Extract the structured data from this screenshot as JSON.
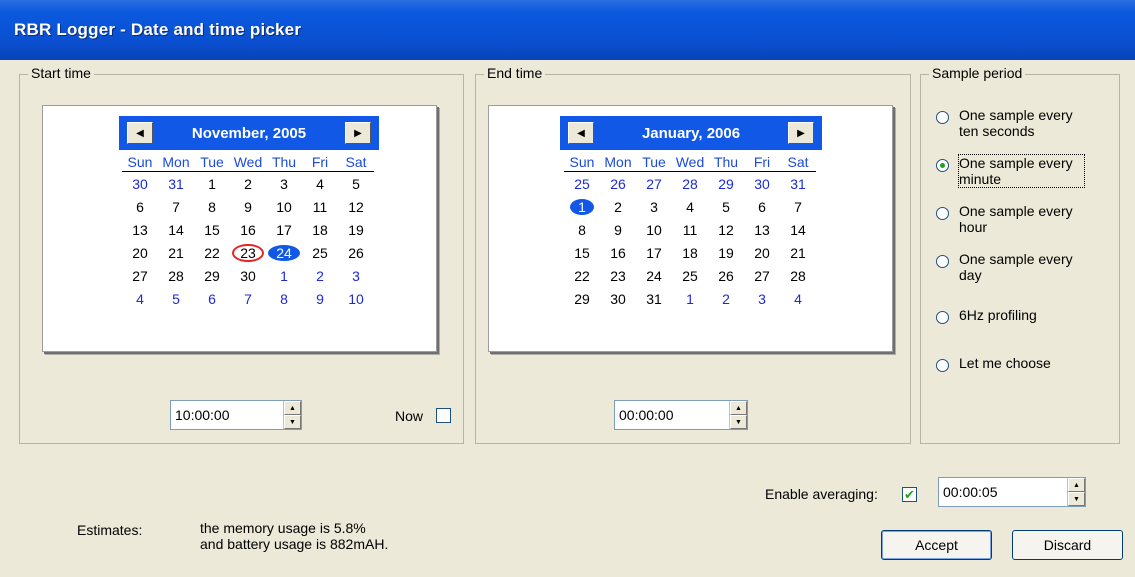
{
  "window": {
    "title": "RBR Logger - Date and time picker"
  },
  "start": {
    "legend": "Start time",
    "month_title": "November, 2005",
    "prev_icon": "triangle-left",
    "next_icon": "triangle-right",
    "days_of_week": [
      "Sun",
      "Mon",
      "Tue",
      "Wed",
      "Thu",
      "Fri",
      "Sat"
    ],
    "weeks": [
      [
        "30",
        "31",
        "1",
        "2",
        "3",
        "4",
        "5"
      ],
      [
        "6",
        "7",
        "8",
        "9",
        "10",
        "11",
        "12"
      ],
      [
        "13",
        "14",
        "15",
        "16",
        "17",
        "18",
        "19"
      ],
      [
        "20",
        "21",
        "22",
        "23",
        "24",
        "25",
        "26"
      ],
      [
        "27",
        "28",
        "29",
        "30",
        "1",
        "2",
        "3"
      ],
      [
        "4",
        "5",
        "6",
        "7",
        "8",
        "9",
        "10"
      ]
    ],
    "today": "23",
    "selected": "24",
    "time_value": "10:00:00",
    "now_label": "Now",
    "now_checked": false
  },
  "end": {
    "legend": "End time",
    "month_title": "January, 2006",
    "prev_icon": "triangle-left",
    "next_icon": "triangle-right",
    "days_of_week": [
      "Sun",
      "Mon",
      "Tue",
      "Wed",
      "Thu",
      "Fri",
      "Sat"
    ],
    "weeks": [
      [
        "25",
        "26",
        "27",
        "28",
        "29",
        "30",
        "31"
      ],
      [
        "1",
        "2",
        "3",
        "4",
        "5",
        "6",
        "7"
      ],
      [
        "8",
        "9",
        "10",
        "11",
        "12",
        "13",
        "14"
      ],
      [
        "15",
        "16",
        "17",
        "18",
        "19",
        "20",
        "21"
      ],
      [
        "22",
        "23",
        "24",
        "25",
        "26",
        "27",
        "28"
      ],
      [
        "29",
        "30",
        "31",
        "1",
        "2",
        "3",
        "4"
      ]
    ],
    "selected": "1",
    "time_value": "00:00:00"
  },
  "sample_period": {
    "legend": "Sample period",
    "options": [
      {
        "label": "One sample every ten seconds",
        "checked": false
      },
      {
        "label": "One sample every minute",
        "checked": true
      },
      {
        "label": "One sample every hour",
        "checked": false
      },
      {
        "label": "One sample every day",
        "checked": false
      },
      {
        "label": "6Hz profiling",
        "checked": false
      },
      {
        "label": "Let me choose",
        "checked": false
      }
    ]
  },
  "averaging": {
    "label": "Enable averaging:",
    "checked": true,
    "value": "00:00:05"
  },
  "estimates": {
    "label": "Estimates:",
    "line1": "the memory usage is 5.8%",
    "line2": "and battery usage is 882mAH."
  },
  "buttons": {
    "accept": "Accept",
    "discard": "Discard"
  },
  "colors": {
    "titlebar": "#0a4fd0",
    "calendar_header": "#1258e6",
    "today_circle": "#e12727",
    "check": "#21a121"
  }
}
